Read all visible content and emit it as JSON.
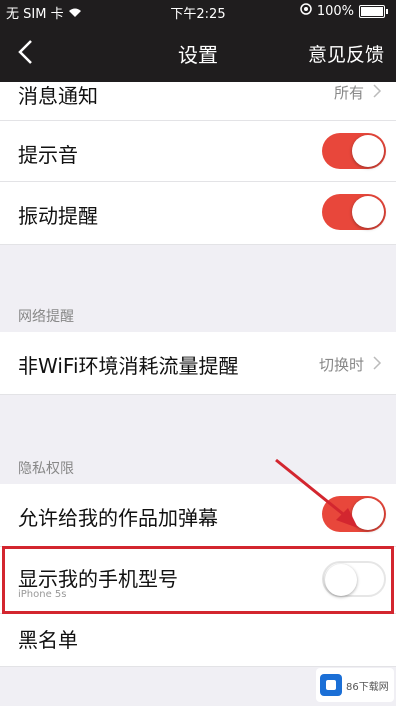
{
  "status": {
    "carrier": "无 SIM 卡",
    "time": "下午2:25",
    "battery": "100%"
  },
  "nav": {
    "title": "设置",
    "feedback": "意见反馈"
  },
  "rows": {
    "notifications": {
      "label": "消息通知",
      "value": "所有"
    },
    "sound": {
      "label": "提示音",
      "on": true
    },
    "vibrate": {
      "label": "振动提醒",
      "on": true
    },
    "wifi": {
      "label": "非WiFi环境消耗流量提醒",
      "value": "切换时"
    },
    "danmaku": {
      "label": "允许给我的作品加弹幕",
      "on": true
    },
    "phone_model": {
      "label": "显示我的手机型号",
      "sub": "iPhone 5s",
      "on": false
    },
    "blacklist": {
      "label": "黑名单"
    }
  },
  "sections": {
    "network": "网络提醒",
    "privacy": "隐私权限"
  },
  "watermark": "86下载网",
  "colors": {
    "accent": "#e8473b",
    "highlight": "#d3262f",
    "nav": "#1f1d1e"
  }
}
